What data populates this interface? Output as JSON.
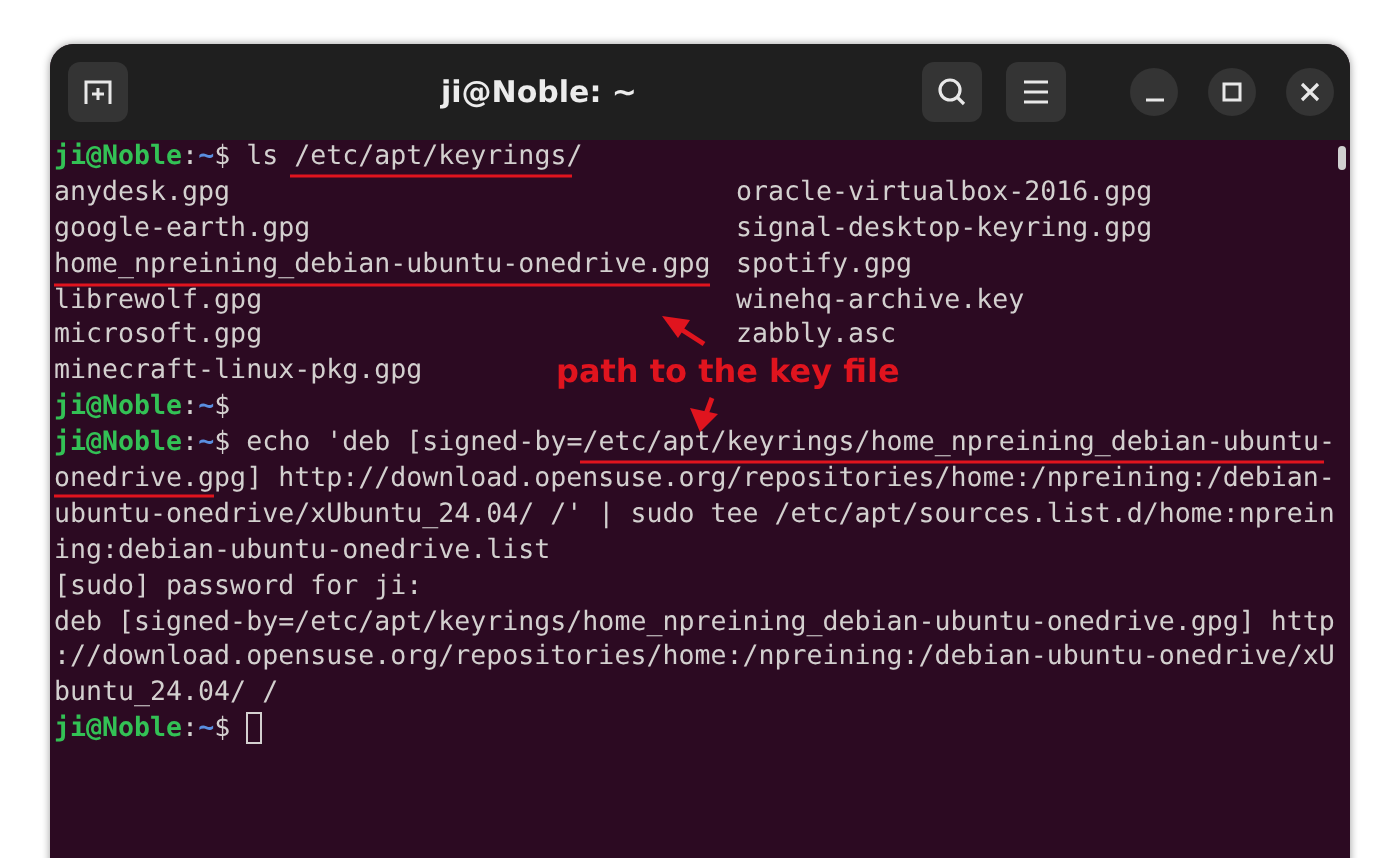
{
  "window": {
    "title": "ji@Noble: ~"
  },
  "terminal": {
    "lines": [
      {
        "kind": "prompt",
        "user": "ji@Noble",
        "separator": ":",
        "path": "~",
        "symbol": "$",
        "command": "ls /etc/apt/keyrings/",
        "cursor": false
      },
      {
        "kind": "columns",
        "cells": [
          "anydesk.gpg",
          "oracle-virtualbox-2016.gpg"
        ]
      },
      {
        "kind": "columns",
        "cells": [
          "google-earth.gpg",
          "signal-desktop-keyring.gpg"
        ]
      },
      {
        "kind": "columns",
        "cells": [
          "home_npreining_debian-ubuntu-onedrive.gpg",
          "spotify.gpg"
        ]
      },
      {
        "kind": "columns",
        "cells": [
          "librewolf.gpg",
          "winehq-archive.key"
        ]
      },
      {
        "kind": "columns",
        "cells": [
          "microsoft.gpg",
          "zabbly.asc"
        ]
      },
      {
        "kind": "columns",
        "cells": [
          "minecraft-linux-pkg.gpg"
        ]
      },
      {
        "kind": "prompt",
        "user": "ji@Noble",
        "separator": ":",
        "path": "~",
        "symbol": "$",
        "cursor": false
      },
      {
        "kind": "prompt",
        "user": "ji@Noble",
        "separator": ":",
        "path": "~",
        "symbol": "$",
        "command": "echo 'deb [signed-by=/etc/apt/keyrings/home_npreining_debian-ubuntu-",
        "cursor": false
      },
      {
        "kind": "output",
        "text": "onedrive.gpg] http://download.opensuse.org/repositories/home:/npreining:/debian-"
      },
      {
        "kind": "output",
        "text": "ubuntu-onedrive/xUbuntu_24.04/ /' | sudo tee /etc/apt/sources.list.d/home:nprein"
      },
      {
        "kind": "output",
        "text": "ing:debian-ubuntu-onedrive.list"
      },
      {
        "kind": "output",
        "text": "[sudo] password for ji:"
      },
      {
        "kind": "output",
        "text": "deb [signed-by=/etc/apt/keyrings/home_npreining_debian-ubuntu-onedrive.gpg] http"
      },
      {
        "kind": "output",
        "text": "://download.opensuse.org/repositories/home:/npreining:/debian-ubuntu-onedrive/xU"
      },
      {
        "kind": "output",
        "text": "buntu_24.04/ /"
      },
      {
        "kind": "prompt",
        "user": "ji@Noble",
        "separator": ":",
        "path": "~",
        "symbol": "$",
        "cursor": true
      }
    ]
  },
  "annotation": {
    "label": "path to the key file"
  }
}
